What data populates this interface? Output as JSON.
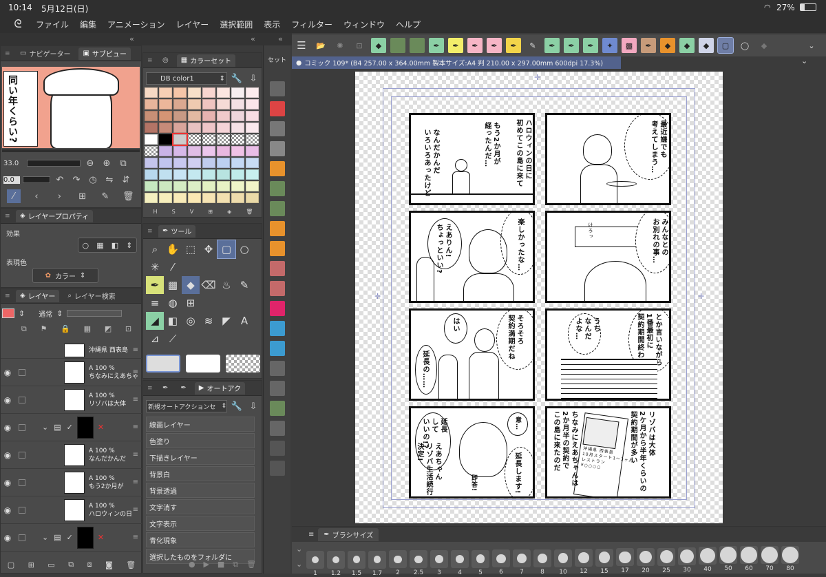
{
  "status": {
    "time": "10:14",
    "date": "5月12日(日)",
    "battery": "27%"
  },
  "menu": [
    "ファイル",
    "編集",
    "アニメーション",
    "レイヤー",
    "選択範囲",
    "表示",
    "フィルター",
    "ウィンドウ",
    "ヘルプ"
  ],
  "navigator": {
    "tab_navigator": "ナビゲーター",
    "tab_subview": "サブビュー",
    "zoom": "33.0",
    "rotate": "0.0"
  },
  "subview_text": "同い年くらい?",
  "colorset": {
    "title": "カラーセット",
    "set_name": "DB color1",
    "hsv": [
      "H",
      "S",
      "V"
    ]
  },
  "layer_property": {
    "title": "レイヤープロパティ",
    "effect_label": "効果",
    "color_label": "表現色",
    "color_value": "カラー"
  },
  "tool": {
    "title": "ツール"
  },
  "autoaction": {
    "title": "オートアク",
    "set_name": "新規オートアクションセ",
    "items": [
      "線画レイヤー",
      "色塗り",
      "下描きレイヤー",
      "背景白",
      "背景透過",
      "文字消す",
      "文字表示",
      "青化現象",
      "選択したものをフォルダに"
    ]
  },
  "layers": {
    "tab_layer": "レイヤー",
    "tab_search": "レイヤー検索",
    "blend": "通常",
    "rows": [
      {
        "pct": "",
        "name": "沖縄県 西表島"
      },
      {
        "pct": "100 %",
        "name": "ちなみにえあちゃ"
      },
      {
        "pct": "100 %",
        "name": "リゾバは大体"
      },
      {
        "pct": "",
        "name": ""
      },
      {
        "pct": "100 %",
        "name": "なんだかんだ"
      },
      {
        "pct": "100 %",
        "name": "もう2か月が"
      },
      {
        "pct": "100 %",
        "name": "ハロウィンの日"
      },
      {
        "pct": "",
        "name": ""
      }
    ]
  },
  "strip": {
    "mode": "セット"
  },
  "document": {
    "tab": "コミック 109* (B4 257.00 x 364.00mm 製本サイズ:A4 判 210.00 x 297.00mm 600dpi 17.3%)"
  },
  "comic": {
    "p1": "ハロウィンの日に\n初めてこの島に来て",
    "p1b": "もう2か月が\n経ったんだ…",
    "p1c": "なんだかんだ\nいろいろあったけど",
    "p2": "最近嫌でも\n考えてしまう…",
    "p3": "えありん!\nちょっといい?",
    "p3b": "楽しかったな…",
    "p3c": "けろっ",
    "p4": "みんなとの\nお別れの事…",
    "p5": "はい",
    "p5b": "そろそろ\n契約満期だね",
    "p5c": "延長の……",
    "p6": "とか言いながら\n1番最初に\n契約期間終わるの",
    "p6b": "うち\nなんだ\nよな…",
    "p7": "延長\nして\nいいの!?",
    "p7b": "えあちゃん\nリゾバ生活続行\n決定!",
    "p7c": "意…",
    "p7d": "延長します!",
    "p7e": "即答!",
    "p8": "リゾバは大体\n2ケ月から半年くらいの\n契約期間が多い",
    "p8b": "ちなみにえあちゃんは\n2か月半の契約で\nこの島に来たのだ",
    "p8c": "沖縄県 西表島\n10月スタート1〜3ヶ月\nレストラン\n¥○○○○"
  },
  "brush": {
    "title": "ブラシサイズ",
    "sizes": [
      "1",
      "1.2",
      "1.5",
      "1.7",
      "2",
      "2.5",
      "3",
      "4",
      "5",
      "6",
      "7",
      "8",
      "10",
      "12",
      "15",
      "17",
      "20",
      "25",
      "30",
      "40",
      "50",
      "60",
      "70",
      "80"
    ]
  }
}
